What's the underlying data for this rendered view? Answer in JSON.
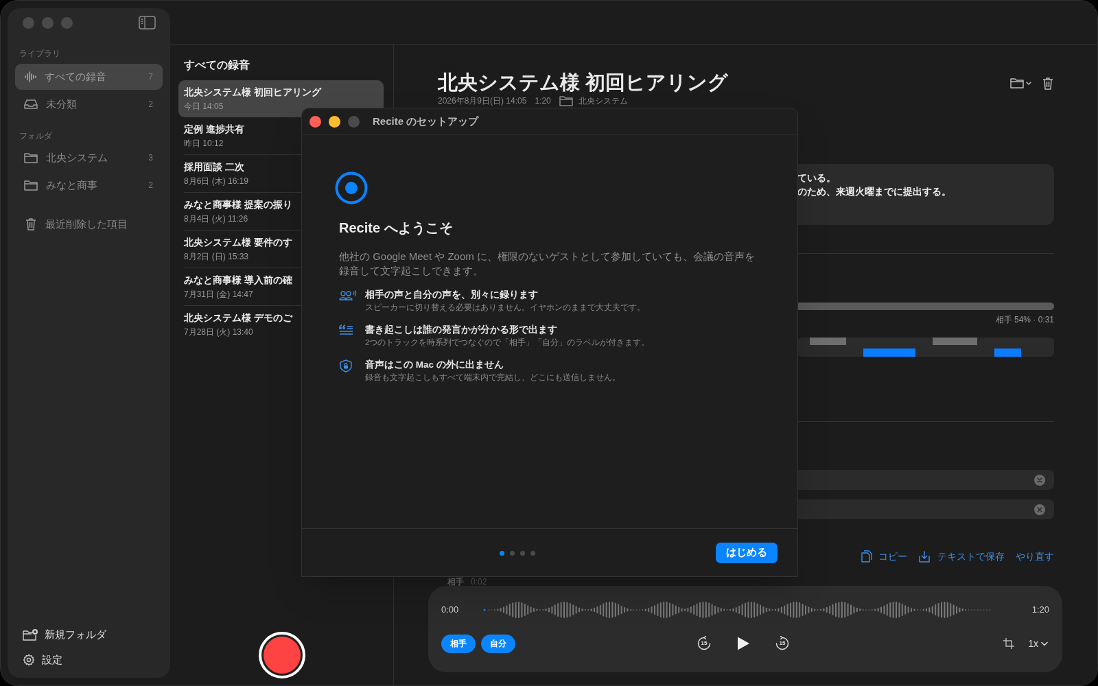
{
  "sidebar": {
    "sections": [
      {
        "heading": "ライブラリ",
        "items": [
          {
            "kind": "waveform",
            "label": "すべての録音",
            "count": "7",
            "selected": true
          },
          {
            "kind": "inbox",
            "label": "未分類",
            "count": "2",
            "selected": false
          }
        ]
      },
      {
        "heading": "フォルダ",
        "items": [
          {
            "kind": "folder",
            "label": "北央システム",
            "count": "3",
            "selected": false
          },
          {
            "kind": "folder",
            "label": "みなと商事",
            "count": "2",
            "selected": false
          }
        ]
      }
    ],
    "trash": {
      "label": "最近削除した項目"
    },
    "footer": [
      {
        "kind": "new-folder",
        "label": "新規フォルダ"
      },
      {
        "kind": "settings",
        "label": "設定"
      }
    ]
  },
  "recordings": {
    "title": "すべての録音",
    "items": [
      {
        "title": "北央システム様 初回ヒアリング",
        "date": "今日 14:05",
        "selected": true
      },
      {
        "title": "定例 進捗共有",
        "date": "昨日 10:12",
        "selected": false
      },
      {
        "title": "採用面談 二次",
        "date": "8月6日 (木) 16:19",
        "selected": false
      },
      {
        "title": "みなと商事様 提案の振り",
        "date": "8月4日 (火) 11:26",
        "selected": false
      },
      {
        "title": "北央システム様 要件のす",
        "date": "8月2日 (日) 15:33",
        "selected": false
      },
      {
        "title": "みなと商事様 導入前の確",
        "date": "7月31日 (金) 14:47",
        "selected": false
      },
      {
        "title": "北央システム様 デモのご",
        "date": "7月28日 (火) 13:40",
        "selected": false
      }
    ]
  },
  "detail": {
    "title": "北央システム様 初回ヒアリング",
    "meta": {
      "date": "2026年8月9日(日) 14:05",
      "duration": "1:20",
      "folder": "北央システム"
    },
    "summary_lines": [
      "ている。",
      "のため、来週火曜までに提出する。"
    ],
    "ratio_reading": "相手 54% · 0:31",
    "actions": [
      {
        "kind": "copy",
        "label": "コピー"
      },
      {
        "kind": "save",
        "label": "テキストで保存"
      },
      {
        "kind": "redo",
        "label": "やり直す"
      }
    ],
    "transcript_peek": {
      "speaker": "相手",
      "time": "0:02"
    }
  },
  "player": {
    "start": "0:00",
    "end": "1:20",
    "tracks": [
      {
        "label": "相手",
        "on": true
      },
      {
        "label": "自分",
        "on": true
      }
    ],
    "rewind": "15",
    "forward": "15",
    "speed": "1x"
  },
  "setup_dialog": {
    "title": "Recite のセットアップ",
    "heading": "Recite へようこそ",
    "body": "他社の Google Meet や Zoom に、権限のないゲストとして参加していても、会議の音声を録音して文字起こしできます。",
    "features": [
      {
        "kind": "voices",
        "title": "相手の声と自分の声を、別々に録ります",
        "description": "スピーカーに切り替える必要はありません。イヤホンのままで大丈夫です。"
      },
      {
        "kind": "transcript",
        "title": "書き起こしは誰の発言かが分かる形で出ます",
        "description": "2つのトラックを時系列でつなぐので「相手」「自分」のラベルが付きます。"
      },
      {
        "kind": "privacy",
        "title": "音声はこの Mac の外に出ません",
        "description": "録音も文字起こしもすべて端末内で完結し、どこにも送信しません。"
      }
    ],
    "pages": [
      {
        "selected": true
      },
      {
        "selected": false
      },
      {
        "selected": false
      },
      {
        "selected": false
      }
    ],
    "primary_button": "はじめる"
  }
}
